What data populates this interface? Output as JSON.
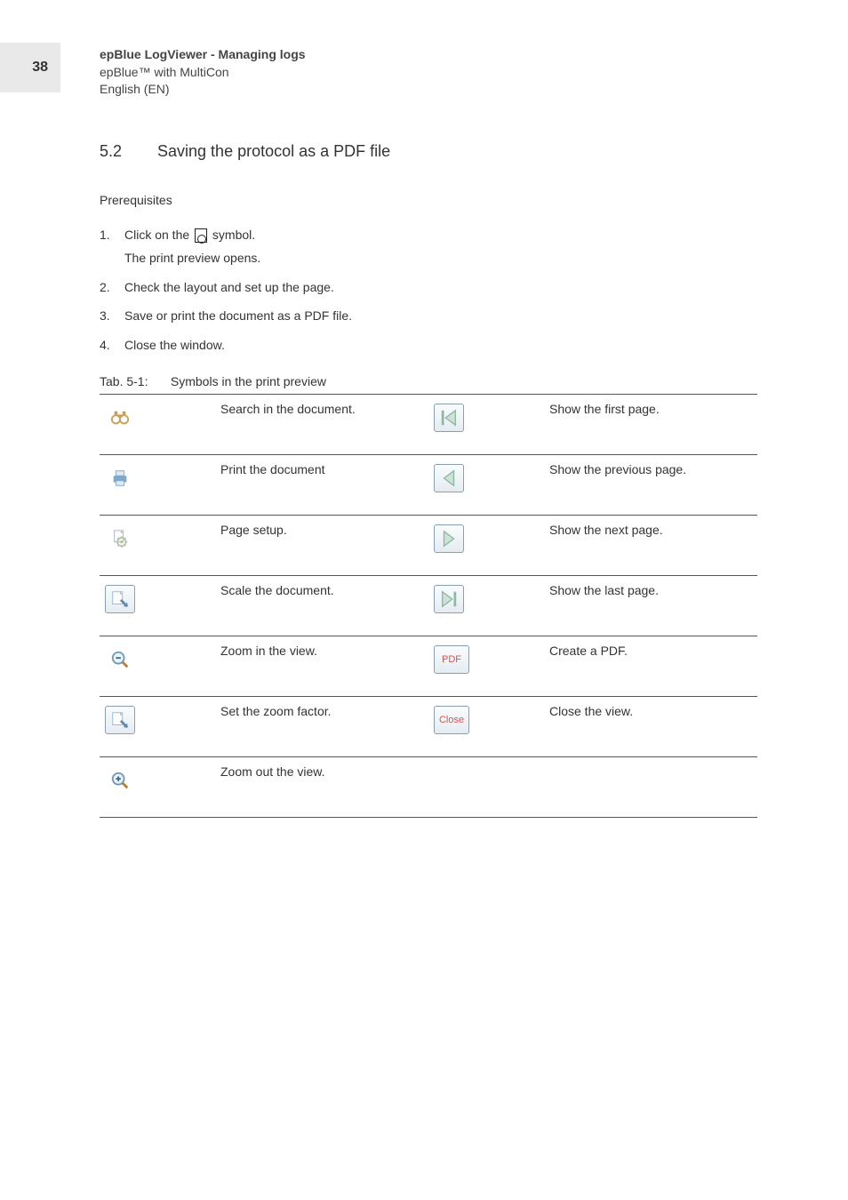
{
  "page_number": "38",
  "header": {
    "line1": "epBlue LogViewer - Managing logs",
    "line2": "epBlue™ with MultiCon",
    "line3": "English (EN)"
  },
  "section": {
    "number": "5.2",
    "title": "Saving the protocol as a PDF file"
  },
  "prerequisites_label": "Prerequisites",
  "steps": [
    {
      "n": "1.",
      "text_before": "Click on the ",
      "text_after": " symbol.",
      "sub": "The print preview opens."
    },
    {
      "n": "2.",
      "text": "Check the layout and set up the page."
    },
    {
      "n": "3.",
      "text": "Save or print the document as a PDF file."
    },
    {
      "n": "4.",
      "text": "Close the window."
    }
  ],
  "table_caption": {
    "label": "Tab. 5-1:",
    "text": "Symbols in the print preview"
  },
  "table_rows": [
    {
      "left_icon": "binoculars",
      "left_desc": "Search in the document.",
      "right_icon": "nav-first",
      "right_desc": "Show the first page."
    },
    {
      "left_icon": "printer",
      "left_desc": "Print the document",
      "right_icon": "nav-prev",
      "right_desc": "Show the previous page."
    },
    {
      "left_icon": "page-setup",
      "left_desc": "Page setup.",
      "right_icon": "nav-next",
      "right_desc": "Show the next page."
    },
    {
      "left_icon": "scale-doc",
      "left_desc": "Scale the document.",
      "right_icon": "nav-last",
      "right_desc": "Show the last page."
    },
    {
      "left_icon": "zoom-in",
      "left_desc": "Zoom in the view.",
      "right_icon": "pdf-text",
      "right_desc": "Create a PDF."
    },
    {
      "left_icon": "zoom-factor",
      "left_desc": "Set the zoom factor.",
      "right_icon": "close-text",
      "right_desc": "Close the view."
    },
    {
      "left_icon": "zoom-out",
      "left_desc": "Zoom out the view.",
      "right_icon": "",
      "right_desc": ""
    }
  ]
}
